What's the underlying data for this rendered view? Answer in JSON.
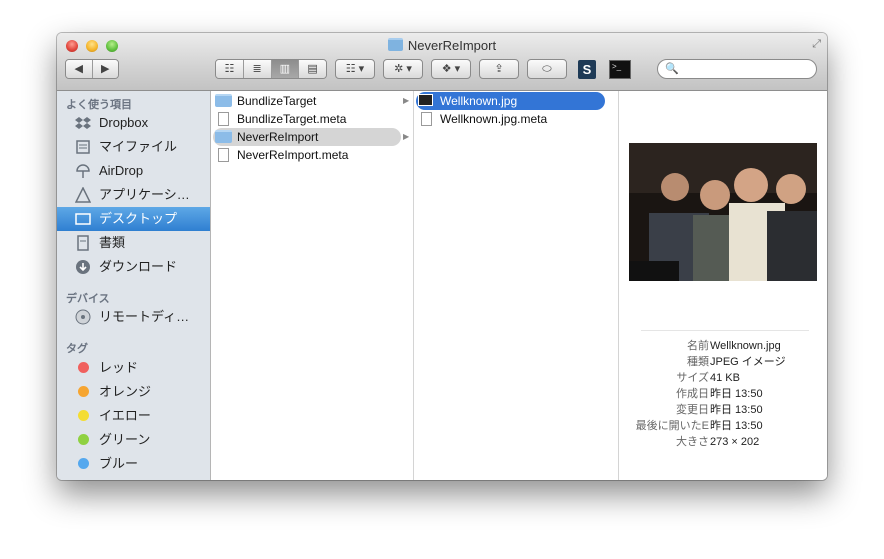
{
  "window": {
    "title": "NeverReImport"
  },
  "toolbar": {
    "nav_back": "◀",
    "nav_forward": "▶",
    "views": [
      "☷",
      "≣",
      "▥",
      "▤"
    ],
    "arrange": "☷ ▾",
    "action": "✲ ▾",
    "dropbox": "❖ ▾",
    "share": "⇪",
    "tag": "⬭",
    "search_placeholder": ""
  },
  "sidebar": {
    "favorites_header": "よく使う項目",
    "favorites": [
      {
        "label": "Dropbox",
        "icon": "dropbox-icon"
      },
      {
        "label": "マイファイル",
        "icon": "all-files-icon"
      },
      {
        "label": "AirDrop",
        "icon": "airdrop-icon"
      },
      {
        "label": "アプリケーシ…",
        "icon": "applications-icon"
      },
      {
        "label": "デスクトップ",
        "icon": "desktop-icon"
      },
      {
        "label": "書類",
        "icon": "documents-icon"
      },
      {
        "label": "ダウンロード",
        "icon": "downloads-icon"
      }
    ],
    "devices_header": "デバイス",
    "devices": [
      {
        "label": "リモートディ…",
        "icon": "remote-disc-icon"
      }
    ],
    "tags_header": "タグ",
    "tags": [
      {
        "label": "レッド",
        "color": "#f0605e"
      },
      {
        "label": "オレンジ",
        "color": "#f6a531"
      },
      {
        "label": "イエロー",
        "color": "#f4dd32"
      },
      {
        "label": "グリーン",
        "color": "#8fd141"
      },
      {
        "label": "ブルー",
        "color": "#55a8ee"
      }
    ]
  },
  "column1": [
    {
      "name": "BundlizeTarget",
      "kind": "folder"
    },
    {
      "name": "BundlizeTarget.meta",
      "kind": "file"
    },
    {
      "name": "NeverReImport",
      "kind": "folder"
    },
    {
      "name": "NeverReImport.meta",
      "kind": "file"
    }
  ],
  "column2": [
    {
      "name": "Wellknown.jpg",
      "kind": "image"
    },
    {
      "name": "Wellknown.jpg.meta",
      "kind": "file"
    }
  ],
  "preview": {
    "rows": [
      {
        "key": "名前",
        "value": "Wellknown.jpg"
      },
      {
        "key": "種類",
        "value": "JPEG イメージ"
      },
      {
        "key": "サイズ",
        "value": "41 KB"
      },
      {
        "key": "作成日",
        "value": "昨日 13:50"
      },
      {
        "key": "変更日",
        "value": "昨日 13:50"
      },
      {
        "key": "最後に開いたE",
        "value": "昨日 13:50"
      },
      {
        "key": "大きさ",
        "value": "273 × 202"
      }
    ]
  }
}
